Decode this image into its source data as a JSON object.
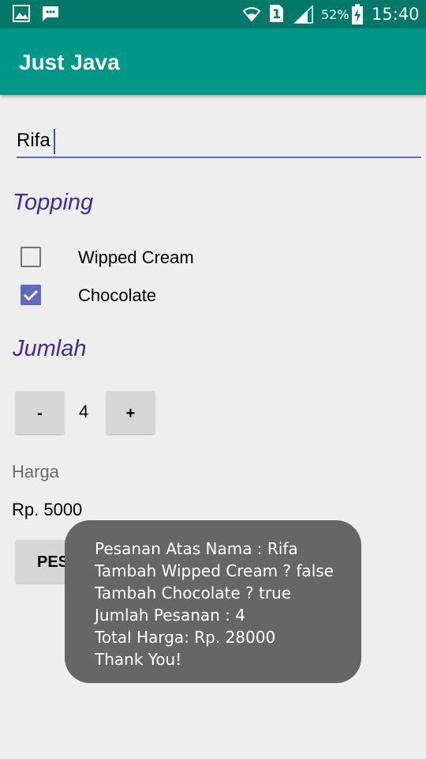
{
  "status_bar": {
    "battery_percent": "52%",
    "time": "15:40",
    "sim_slot": "1",
    "icons": [
      "gallery-icon",
      "message-icon",
      "wifi-icon",
      "sim-icon",
      "signal-icon",
      "battery-charging-icon"
    ]
  },
  "app_bar": {
    "title": "Just Java"
  },
  "name_field": {
    "value": "Rifa"
  },
  "topping": {
    "heading": "Topping",
    "options": [
      {
        "label": "Wipped Cream",
        "checked": false
      },
      {
        "label": "Chocolate",
        "checked": true
      }
    ]
  },
  "quantity": {
    "heading": "Jumlah",
    "decrement_label": "-",
    "value": "4",
    "increment_label": "+"
  },
  "price": {
    "label": "Harga",
    "value": "Rp. 5000"
  },
  "order_button": {
    "label": "PESAN"
  },
  "toast": {
    "lines": [
      "Pesanan Atas Nama : Rifa",
      "Tambah Wipped Cream ? false",
      "Tambah Chocolate ? true",
      "Jumlah Pesanan : 4",
      "Total Harga: Rp. 28000",
      "Thank You!"
    ]
  },
  "colors": {
    "status_bar": "#00796b",
    "app_bar": "#009688",
    "accent": "#5c6bc0",
    "heading": "#4527a0",
    "background": "#eeeeee",
    "toast": "#666666"
  }
}
